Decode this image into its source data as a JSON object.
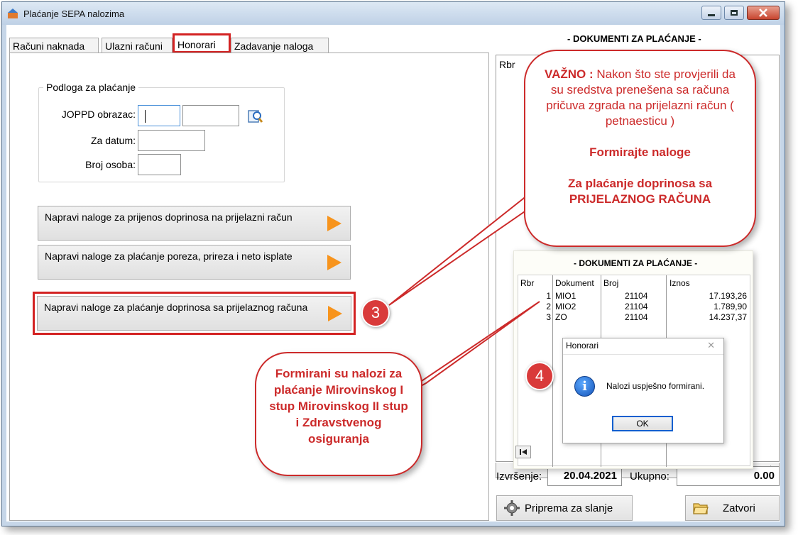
{
  "window": {
    "title": "Plaćanje SEPA nalozima",
    "controls": {
      "minimize": "minimize",
      "maximize": "maximize",
      "close": "close"
    }
  },
  "tabs": [
    {
      "label": "Računi naknada",
      "active": false
    },
    {
      "label": "Ulazni računi",
      "active": false
    },
    {
      "label": "Honorari",
      "active": true
    },
    {
      "label": "Zadavanje naloga",
      "active": false
    }
  ],
  "basis": {
    "group_label": "Podloga za plaćanje",
    "joppd_label": "JOPPD obrazac:",
    "joppd_value_1": "",
    "joppd_value_2": "",
    "date_label": "Za datum:",
    "date_value": "",
    "persons_label": "Broj osoba:",
    "persons_value": ""
  },
  "actions": [
    {
      "label": "Napravi naloge za prijenos doprinosa na prijelazni račun"
    },
    {
      "label": "Napravi naloge za plaćanje poreza, prireza i neto isplate"
    },
    {
      "label": "Napravi naloge za plaćanje doprinosa sa prijelaznog računa"
    }
  ],
  "documents": {
    "title": "- DOKUMENTI ZA PLAĆANJE -",
    "col_rbr": "Rbr",
    "execution_label": "Izvršenje:",
    "execution_date": "20.04.2021",
    "total_label": "Ukupno:",
    "total_value": "0.00"
  },
  "inset": {
    "title": "- DOKUMENTI ZA PLAĆANJE -",
    "columns": [
      "Rbr",
      "Dokument",
      "Broj",
      "Iznos"
    ],
    "rows": [
      {
        "rbr": "1",
        "dokument": "MIO1",
        "broj": "21104",
        "iznos": "17.193,26"
      },
      {
        "rbr": "2",
        "dokument": "MIO2",
        "broj": "21104",
        "iznos": "1.789,90"
      },
      {
        "rbr": "3",
        "dokument": "ZO",
        "broj": "21104",
        "iznos": "14.237,37"
      }
    ]
  },
  "message_box": {
    "title": "Honorari",
    "close": "✕",
    "icon": "i",
    "text": "Nalozi uspješno formirani.",
    "ok": "OK"
  },
  "buttons": {
    "prepare": "Priprema za slanje",
    "close": "Zatvori"
  },
  "callouts": {
    "important_head": "VAŽNO :",
    "important_text": "Nakon što ste provjerili da su sredstva prenešena sa računa pričuva zgrada na prijelazni račun ( petnaesticu )",
    "form_orders": "Formirajte naloge",
    "pay_from": "Za plaćanje doprinosa sa PRIJELAZNOG RAČUNA",
    "formed_text": "Formirani su nalozi za plaćanje Mirovinskog I stup Mirovinskog II stup i Zdravstvenog osiguranja",
    "badge_3": "3",
    "badge_4": "4"
  },
  "colors": {
    "accent_red": "#cc2a2a",
    "arrow_orange": "#f7941d",
    "info_blue": "#1553b8"
  }
}
